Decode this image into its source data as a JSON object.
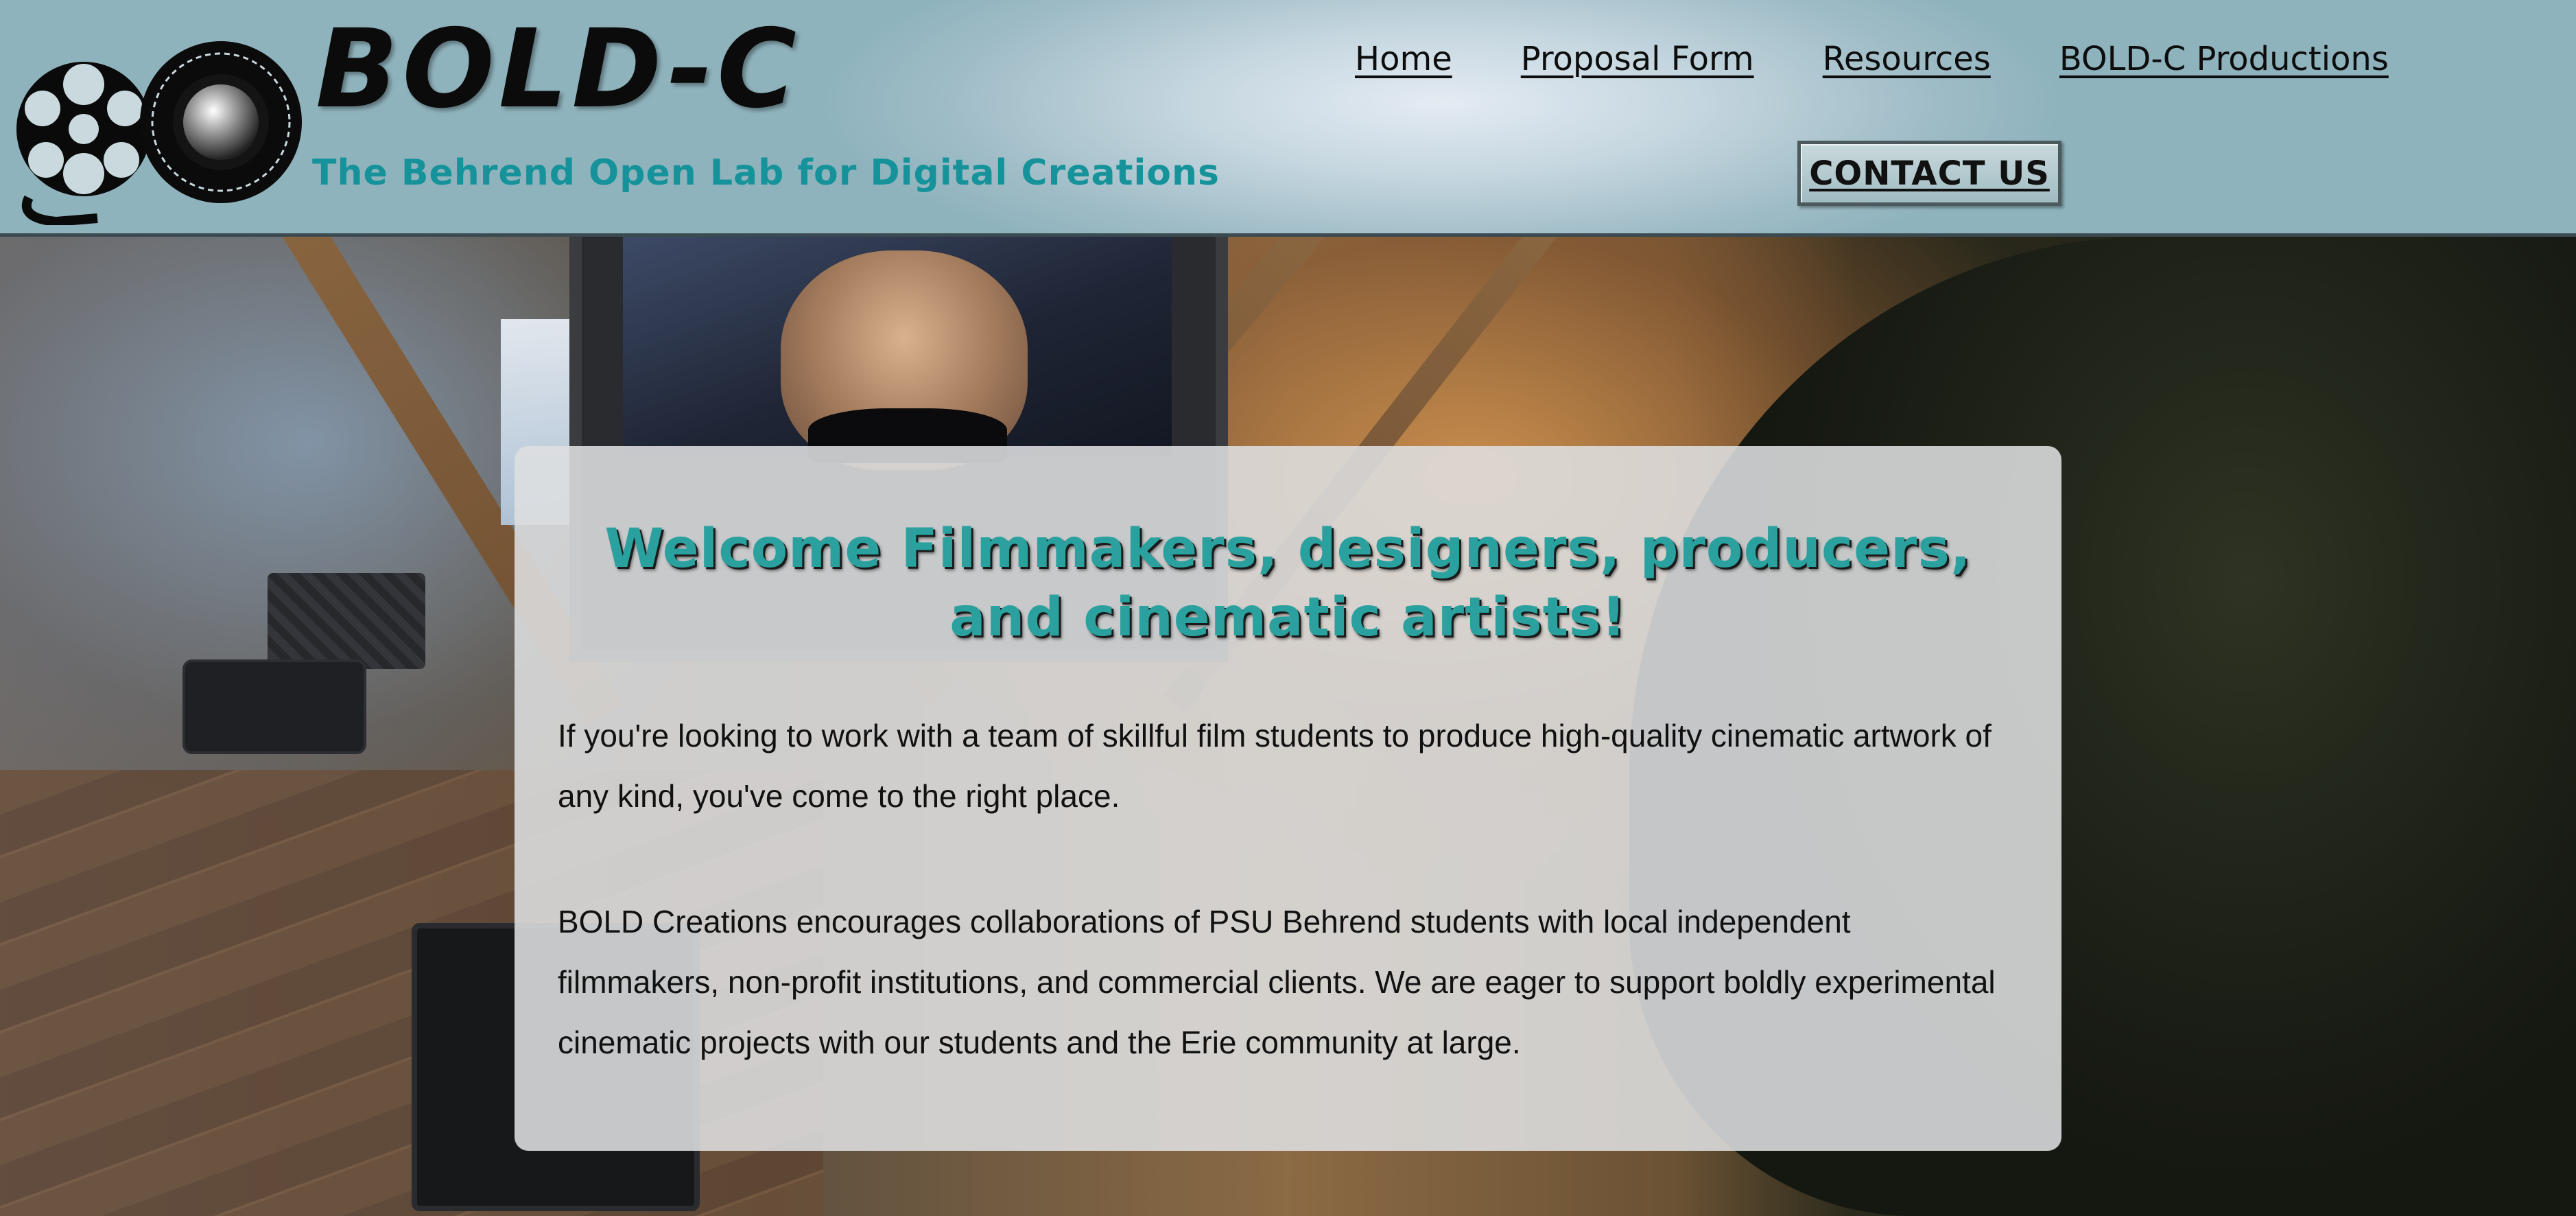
{
  "header": {
    "brand": "BOLD-C",
    "tagline": "The Behrend Open Lab for Digital Creations",
    "nav": [
      {
        "label": "Home"
      },
      {
        "label": "Proposal Form"
      },
      {
        "label": "Resources"
      },
      {
        "label": "BOLD-C Productions"
      }
    ],
    "contact_label": "CONTACT US"
  },
  "main": {
    "title": "Welcome Filmmakers, designers, producers, and cinematic artists!",
    "paragraphs": [
      "If you're looking to work with a team of skillful film students to produce high-quality cinematic artwork of any kind, you've come to the right place.",
      "BOLD Creations encourages collaborations of PSU Behrend students with local independent filmmakers, non-profit institutions, and commercial clients. We are eager to support boldly experimental cinematic projects with our students and the Erie community at large."
    ]
  },
  "icons": {
    "logo": "film-reel-icon"
  },
  "colors": {
    "accent": "#16939a",
    "title": "#2aa19f",
    "header_bg": "#9fbcc6",
    "card_bg": "#dedfe0"
  }
}
